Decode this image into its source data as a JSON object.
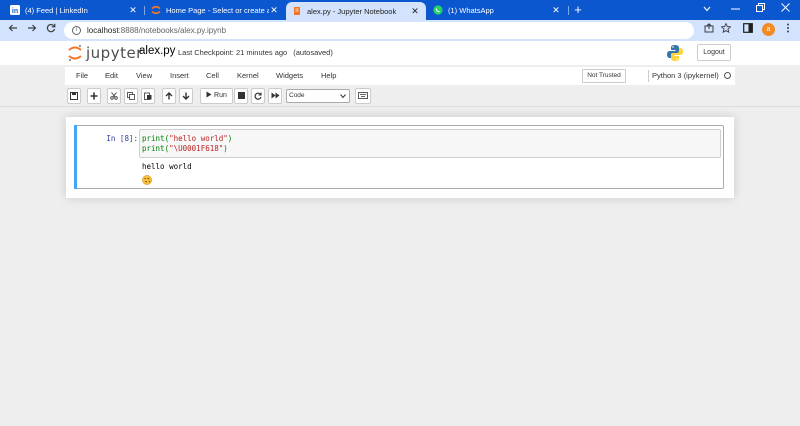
{
  "browser": {
    "tabs": [
      {
        "title": "(4) Feed | LinkedIn",
        "icon": "linkedin-icon",
        "active": false
      },
      {
        "title": "Home Page - Select or create a n",
        "icon": "jupyter-icon",
        "active": false
      },
      {
        "title": "alex.py - Jupyter Notebook",
        "icon": "jupyter-book-icon",
        "active": true
      },
      {
        "title": "(1) WhatsApp",
        "icon": "whatsapp-icon",
        "active": false
      }
    ],
    "close_glyph": "✕",
    "new_tab_glyph": "+",
    "url_host": "localhost",
    "url_path": ":8888/notebooks/alex.py.ipynb",
    "profile_initial": "a",
    "accent_color": "#0b57d0"
  },
  "jupyter": {
    "logo_text": "jupyter",
    "notebook_name": "alex.py",
    "checkpoint": "Last Checkpoint: 21 minutes ago",
    "autosave": "(autosaved)",
    "logout_label": "Logout",
    "menu": [
      "File",
      "Edit",
      "View",
      "Insert",
      "Cell",
      "Kernel",
      "Widgets",
      "Help"
    ],
    "trust_label": "Not Trusted",
    "kernel_name": "Python 3 (ipykernel)",
    "toolbar": {
      "run_label": "Run",
      "cell_type": "Code"
    },
    "cell": {
      "prompt": "In [8]:",
      "code_lines": [
        {
          "fn": "print(",
          "str": "\"hello world\"",
          "end": ")"
        },
        {
          "fn": "print(",
          "str": "\"\\U0001F618\"",
          "end": ")"
        }
      ],
      "output": "hello world",
      "output_emoji": "face-blowing-kiss-emoji"
    },
    "cell_accent_color": "#42a5f5"
  }
}
